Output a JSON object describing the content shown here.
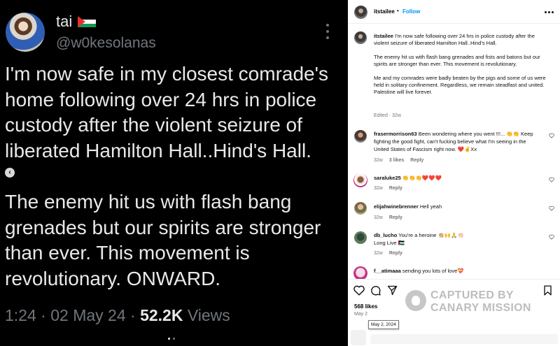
{
  "tweet": {
    "display_name": "tai",
    "flag_icon": "palestine-flag-icon",
    "handle": "@w0kesolanas",
    "paragraph1": "I'm now safe in my closest comrade's home following over 24 hrs in police custody after the violent seizure of liberated Hamilton Hall..Hind's Hall.",
    "paragraph2": "The enemy hit us with flash bang grenades but our spirits are stronger than ever. This movement is revolutionary. ONWARD.",
    "time": "1:24",
    "separator": "·",
    "date": "02 May 24",
    "views_count": "52.2K",
    "views_label": "Views",
    "nav_icon": "chevron-left-icon"
  },
  "instagram": {
    "username": "itstailee",
    "dot": "•",
    "follow_label": "Follow",
    "caption_user": "itstailee",
    "caption_p1": "I'm now safe following over 24 hrs in police custody after the violent seizure of liberated Hamilton Hall..Hind's Hall.",
    "caption_p2": "The enemy hit us with flash bang grenades and fists and batons but our spirits are stronger than ever. This movement is revolutionary.",
    "caption_p3": "Me and my comrades were badly beaten by the pigs and some of us were held in solitary confinement. Regardless, we remain steadfast and united. Palestine will live forever.",
    "edited": "Edited · 32w",
    "comments": [
      {
        "user": "frasermorrison63",
        "text": "Been wondering where you went !!!... 👏👏 Keep fighting the good fight, can't fucking believe what I'm seeing in the United States of Fascism right now. ❤️✌️Xx",
        "age": "32w",
        "likes": "3 likes",
        "reply": "Reply"
      },
      {
        "user": "saraluke25",
        "text": "👏👏👏❤️❤️❤️",
        "age": "32w",
        "reply": "Reply"
      },
      {
        "user": "elijahwinebrenner",
        "text": "Hell yeah",
        "age": "32w",
        "reply": "Reply"
      },
      {
        "user": "db_lucho",
        "text": "You're a heroine 👏🏼🙌🙏👏🏻",
        "text2": "Long Live 🇵🇸",
        "age": "32w",
        "reply": "Reply"
      },
      {
        "user": "f__atimaaa",
        "text": "sending you lots of love💝"
      }
    ],
    "likes": "568 likes",
    "date": "May 2",
    "tooltip_date": "May 2, 2024"
  },
  "watermark": {
    "line1": "CAPTURED BY",
    "line2": "CANARY MISSION"
  },
  "colors": {
    "tweet_bg": "#000000",
    "tweet_text": "#e7e9ea",
    "tweet_muted": "#71767b",
    "ig_follow": "#0095f6",
    "ig_muted": "#737373",
    "watermark": "#bdbdbd"
  }
}
